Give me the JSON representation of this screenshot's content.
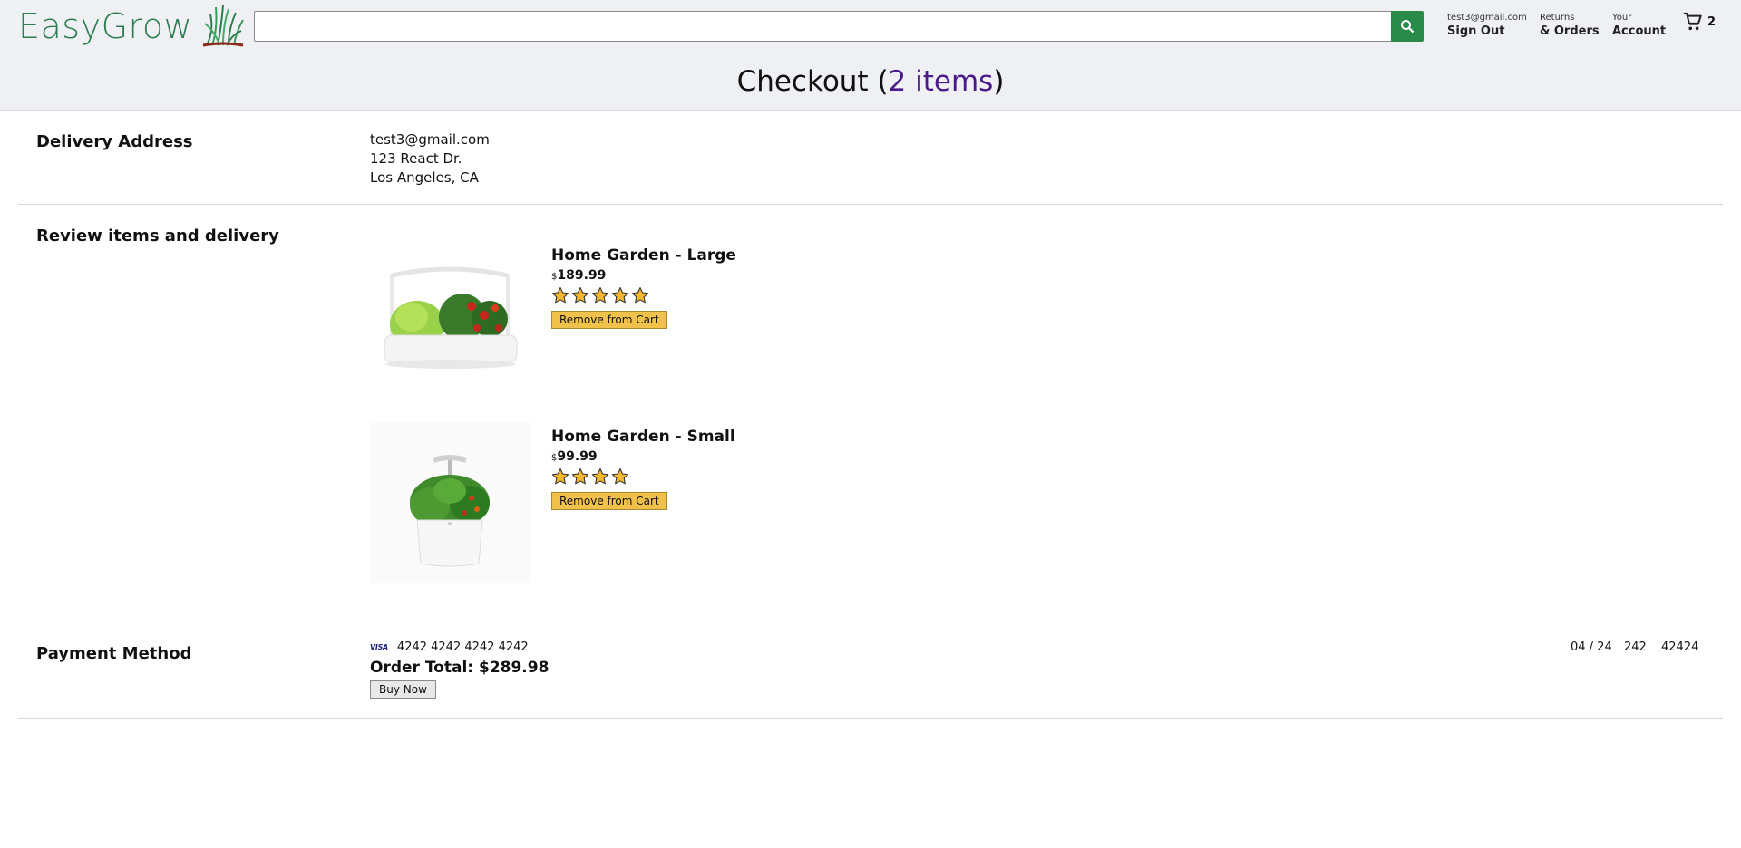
{
  "header": {
    "logo_text": "EasyGrow",
    "search": {
      "value": "",
      "placeholder": ""
    },
    "account": {
      "email": "test3@gmail.com",
      "sign_out": "Sign Out"
    },
    "returns": {
      "top": "Returns",
      "bottom": "& Orders"
    },
    "your_account": {
      "top": "Your",
      "bottom": "Account"
    },
    "cart_count": "2",
    "colors": {
      "brand": "#2e7d4f",
      "search_button": "#2a8a4a",
      "header_bg": "#eff0f3"
    }
  },
  "checkout": {
    "title_prefix": "Checkout (",
    "items_link": "2 items",
    "title_suffix": ")"
  },
  "delivery": {
    "label": "Delivery Address",
    "lines": [
      "test3@gmail.com",
      "123 React Dr.",
      "Los Angeles, CA"
    ]
  },
  "review": {
    "label": "Review items and delivery",
    "items": [
      {
        "title": "Home Garden - Large",
        "currency": "$",
        "price": "189.99",
        "rating": 5,
        "remove_label": "Remove from Cart",
        "image_icon": "large-garden-image"
      },
      {
        "title": "Home Garden - Small",
        "currency": "$",
        "price": "99.99",
        "rating": 4,
        "remove_label": "Remove from Cart",
        "image_icon": "small-garden-image"
      }
    ]
  },
  "payment": {
    "label": "Payment Method",
    "card_brand": "VISA",
    "card_number": "4242 4242 4242 4242",
    "expiry": "04 / 24",
    "cvc": "242",
    "zip": "42424",
    "order_total": "Order Total: $289.98",
    "buy_label": "Buy Now"
  }
}
